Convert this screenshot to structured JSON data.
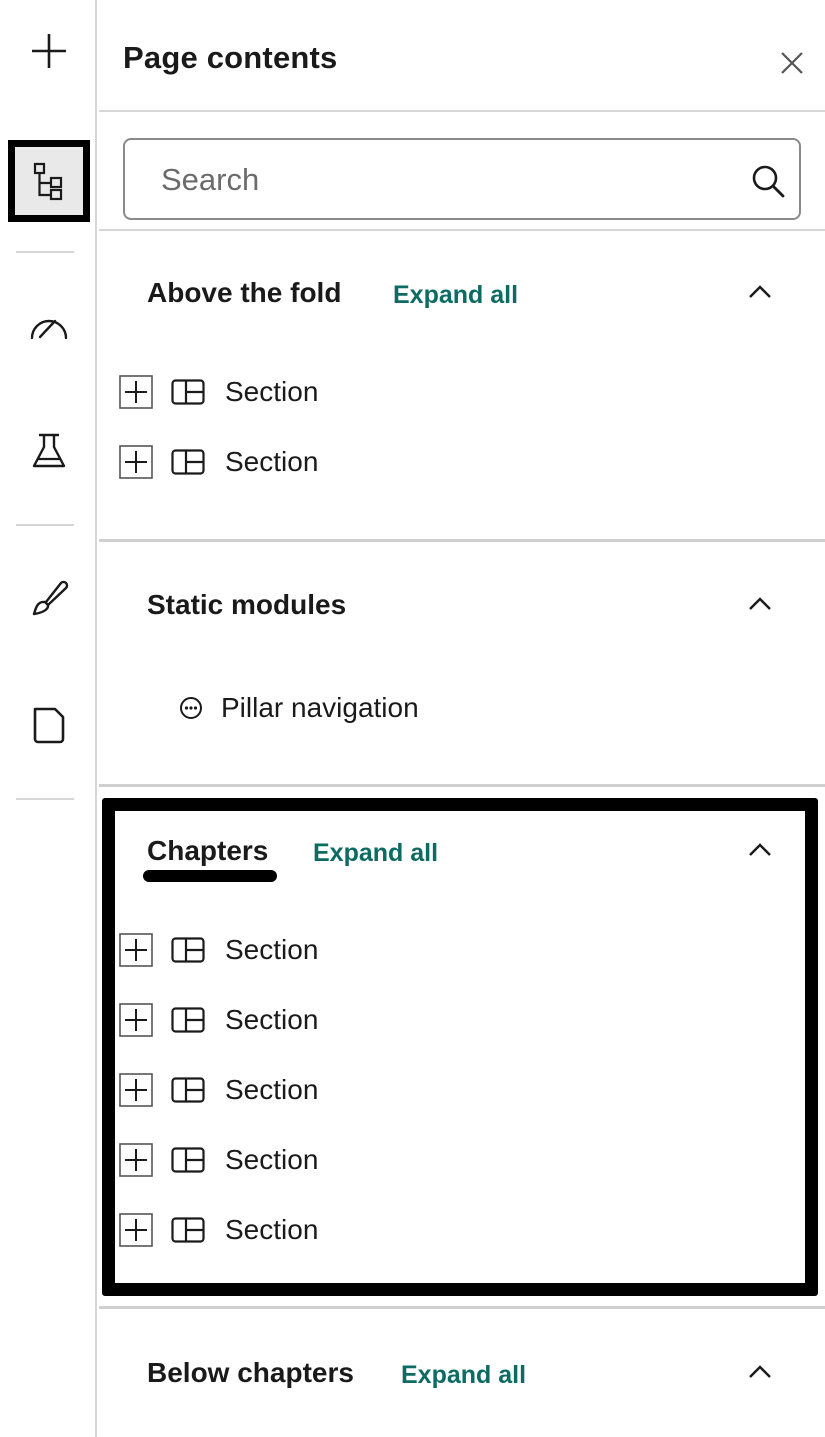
{
  "rail": {
    "items": [
      {
        "icon": "plus-icon"
      },
      {
        "icon": "tree-structure-icon",
        "active": true
      },
      {
        "icon": "gauge-icon"
      },
      {
        "icon": "flask-icon"
      },
      {
        "icon": "paintbrush-icon"
      },
      {
        "icon": "page-icon"
      }
    ]
  },
  "panel": {
    "title": "Page contents",
    "search": {
      "placeholder": "Search",
      "value": ""
    }
  },
  "groups": [
    {
      "title": "Above the fold",
      "expand_label": "Expand all",
      "rows": [
        {
          "label": "Section"
        },
        {
          "label": "Section"
        }
      ]
    },
    {
      "title": "Static modules",
      "rows": [
        {
          "label": "Pillar navigation",
          "icon": "more-circle-icon"
        }
      ]
    },
    {
      "title": "Chapters",
      "expand_label": "Expand all",
      "rows": [
        {
          "label": "Section"
        },
        {
          "label": "Section"
        },
        {
          "label": "Section"
        },
        {
          "label": "Section"
        },
        {
          "label": "Section"
        }
      ]
    },
    {
      "title": "Below chapters",
      "expand_label": "Expand all",
      "rows": []
    }
  ],
  "colors": {
    "accent": "#0c6b63",
    "active_rail_bg": "#e9e9e9",
    "divider": "#d6d6d6"
  }
}
